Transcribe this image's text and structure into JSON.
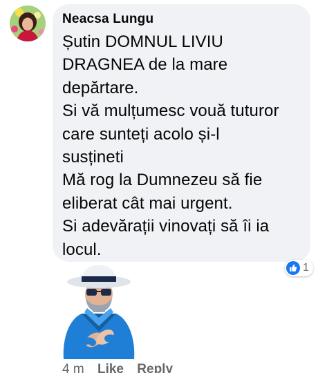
{
  "comment": {
    "author": "Neacsa Lungu",
    "lines": [
      "Șutin DOMNUL LIVIU",
      "DRAGNEA de la mare",
      "depărtare.",
      "Si vă mulțumesc vouă tuturor",
      "care sunteți acolo și-l",
      "susțineti",
      "Mă rog la Dumnezeu să fie",
      "eliberat cât mai urgent.",
      "Si adevărații vinovați să îi ia",
      "locul."
    ],
    "reaction": {
      "icon": "thumbs-up-icon",
      "count": "1"
    },
    "sticker": "applauding-man-sticker"
  },
  "actions": {
    "time": "4 m",
    "like": "Like",
    "reply": "Reply"
  },
  "colors": {
    "bubble": "#f0f2f5",
    "like_blue": "#1877f2",
    "secondary_text": "#65676b"
  }
}
